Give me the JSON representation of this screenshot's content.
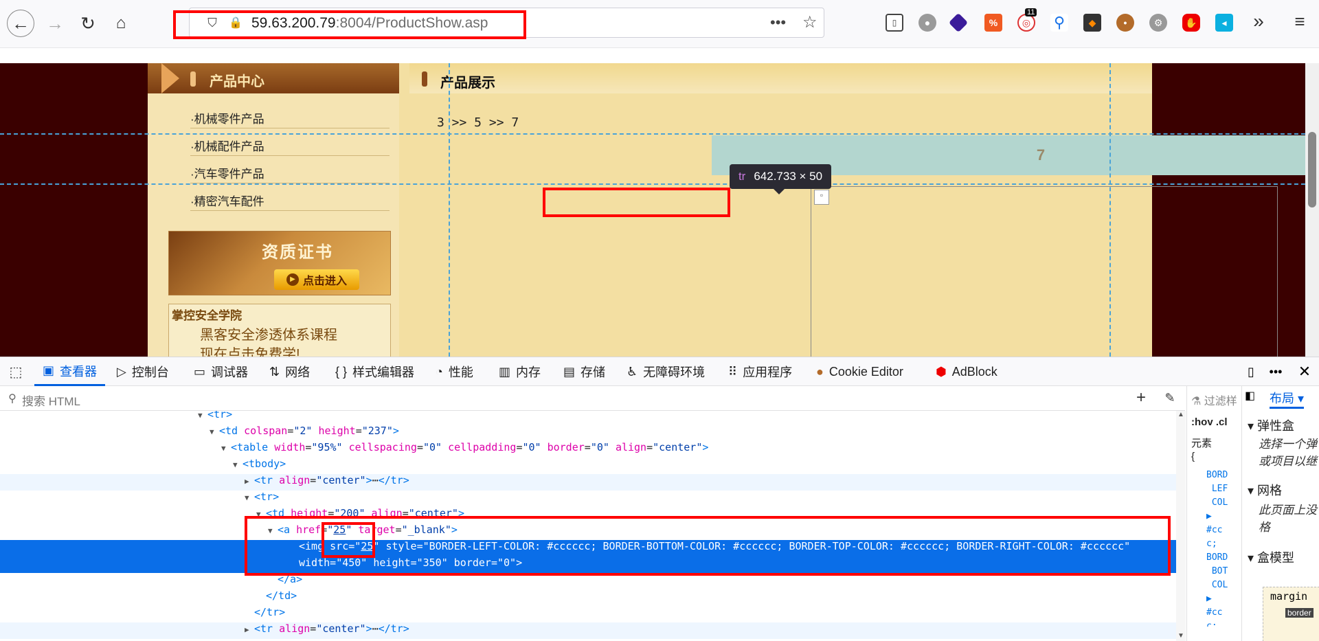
{
  "browser": {
    "url_host": "59.63.200.79",
    "url_rest": ":8004/ProductShow.asp",
    "extension_badge": "11"
  },
  "page": {
    "sidebar": {
      "title": "产品中心",
      "items": [
        "·机械零件产品",
        "·机械配件产品",
        "·汽车零件产品",
        "·精密汽车配件"
      ],
      "cert_title": "资质证书",
      "cert_button": "点击进入",
      "ad_line1": "掌控安全学院",
      "ad_line2": "黑客安全渗透体系课程",
      "ad_line3": "现在点击免费学!"
    },
    "content": {
      "title": "产品展示",
      "breadcrumb": "3 >> 5 >> 7",
      "highlight_number": "7"
    },
    "inspector_tooltip": {
      "tag": "tr",
      "size": "642.733 × 50"
    }
  },
  "devtools": {
    "tabs": [
      "查看器",
      "控制台",
      "调试器",
      "网络",
      "样式编辑器",
      "性能",
      "内存",
      "存储",
      "无障碍环境",
      "应用程序",
      "Cookie Editor",
      "AdBlock"
    ],
    "search_placeholder": "搜索 HTML",
    "rules_filter": "过滤样",
    "rules_hov": ":hov",
    "rules_cls": ".cl",
    "rules_element": "元素",
    "rules_brace": "{",
    "layout_tab": "布局",
    "layout_flex": "弹性盒",
    "layout_flex_text": "选择一个弹\n或项目以继",
    "layout_grid": "网格",
    "layout_grid_text": "此页面上没\n格",
    "layout_box": "盒模型",
    "layout_margin": "margin",
    "layout_border": "border",
    "markup_lines": [
      {
        "indent": 0,
        "tw": "▼",
        "html": "<span class='tg'>&lt;tr&gt;</span>"
      },
      {
        "indent": 1,
        "tw": "▼",
        "html": "<span class='tg'>&lt;td</span> <span class='at'>colspan</span>=<span class='av'>\"2\"</span> <span class='at'>height</span>=<span class='av'>\"237\"</span><span class='tg'>&gt;</span>"
      },
      {
        "indent": 2,
        "tw": "▼",
        "html": "<span class='tg'>&lt;table</span> <span class='at'>width</span>=<span class='av'>\"95%\"</span> <span class='at'>cellspacing</span>=<span class='av'>\"0\"</span> <span class='at'>cellpadding</span>=<span class='av'>\"0\"</span> <span class='at'>border</span>=<span class='av'>\"0\"</span> <span class='at'>align</span>=<span class='av'>\"center\"</span><span class='tg'>&gt;</span>"
      },
      {
        "indent": 3,
        "tw": "▼",
        "html": "<span class='tg'>&lt;tbody&gt;</span>"
      },
      {
        "indent": 4,
        "tw": "▶",
        "html": "<span class='tg'>&lt;tr</span> <span class='at'>align</span>=<span class='av'>\"center\"</span><span class='tg'>&gt;</span>⋯<span class='tg'>&lt;/tr&gt;</span>"
      },
      {
        "indent": 4,
        "tw": "▼",
        "html": "<span class='tg'>&lt;tr&gt;</span>"
      },
      {
        "indent": 5,
        "tw": "▼",
        "html": "<span class='tg'>&lt;td</span> <span class='at'>height</span>=<span class='av'>\"200\"</span> <span class='at'>align</span>=<span class='av'>\"center\"</span><span class='tg'>&gt;</span>"
      },
      {
        "indent": 6,
        "tw": "▼",
        "html": "<span class='tg'>&lt;a</span> <span class='at'>href</span>=<span class='av'>\"<u>25</u>\"</span> <span class='at'>target</span>=<span class='av'>\"_blank\"</span><span class='tg'>&gt;</span>"
      },
      {
        "indent": 7,
        "tw": "",
        "sel": true,
        "html": "<span class='tg'>&lt;img</span> <span class='at'>src</span>=<span class='av'>\"<u>25</u>\"</span> <span class='at'>style</span>=<span class='av'>\"BORDER-LEFT-COLOR: #cccccc; BORDER-BOTTOM-COLOR: #cccccc; BORDER-TOP-COLOR: #cccccc; BORDER-RIGHT-COLOR: #cccccc\"</span>"
      },
      {
        "indent": 7,
        "tw": "",
        "sel": true,
        "html": "<span class='at'>width</span>=<span class='av'>\"450\"</span> <span class='at'>height</span>=<span class='av'>\"350\"</span> <span class='at'>border</span>=<span class='av'>\"0\"</span><span class='tg'>&gt;</span>"
      },
      {
        "indent": 6,
        "tw": "",
        "html": "<span class='tg'>&lt;/a&gt;</span>"
      },
      {
        "indent": 5,
        "tw": "",
        "html": "<span class='tg'>&lt;/td&gt;</span>"
      },
      {
        "indent": 4,
        "tw": "",
        "html": "<span class='tg'>&lt;/tr&gt;</span>"
      },
      {
        "indent": 4,
        "tw": "▶",
        "html": "<span class='tg'>&lt;tr</span> <span class='at'>align</span>=<span class='av'>\"center\"</span><span class='tg'>&gt;</span>⋯<span class='tg'>&lt;/tr&gt;</span>"
      }
    ]
  }
}
